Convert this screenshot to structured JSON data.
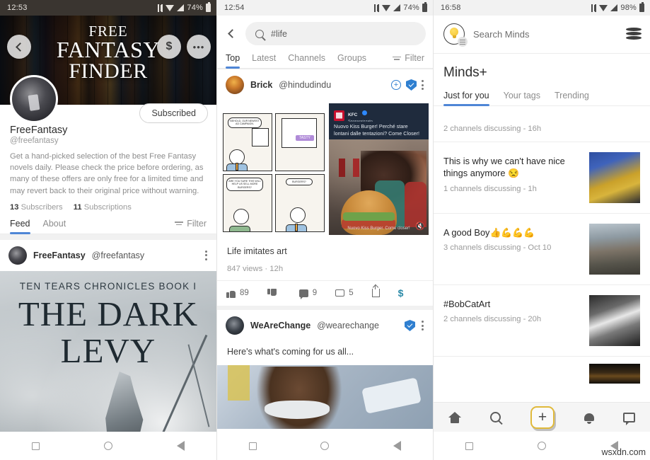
{
  "panel1": {
    "statusbar": {
      "time": "12:53",
      "battery": "74%"
    },
    "banner": {
      "line1": "FREE",
      "line2": "FANTASY",
      "line3": "FINDER"
    },
    "actions": {
      "back": "back-arrow",
      "tip": "$",
      "more": "•••"
    },
    "subscribe_label": "Subscribed",
    "profile": {
      "name": "FreeFantasy",
      "handle": "@freefantasy",
      "bio": "Get a hand-picked selection of the best Free Fantasy novels daily. Please check the price before ordering, as many of these offers are only free for a limited time and may revert back to their original price without warning.",
      "subscribers_count": "13",
      "subscribers_label": "Subscribers",
      "subscriptions_count": "11",
      "subscriptions_label": "Subscriptions"
    },
    "tabs": [
      {
        "label": "Feed",
        "active": true
      },
      {
        "label": "About",
        "active": false
      }
    ],
    "filter_label": "Filter",
    "post": {
      "user": "FreeFantasy",
      "handle": "@freefantasy",
      "cover_series": "TEN TEARS CHRONICLES BOOK I",
      "cover_title_line1": "THE DARK",
      "cover_title_line2": "LEVY"
    }
  },
  "panel2": {
    "statusbar": {
      "time": "12:54",
      "battery": "74%"
    },
    "search": {
      "value": "#life",
      "placeholder": "Search"
    },
    "tabs": [
      {
        "label": "Top",
        "active": true
      },
      {
        "label": "Latest",
        "active": false
      },
      {
        "label": "Channels",
        "active": false
      },
      {
        "label": "Groups",
        "active": false
      }
    ],
    "filter_label": "Filter",
    "post1": {
      "user": "Brick",
      "handle": "@hindudindu",
      "comic_panels": [
        "BEHOLD, OUR NEWEST AD CAMPAIGN.",
        "TASTY",
        "ARE YOU SURE THIS WILL HELP US SELL MORE BURGERS?",
        "BURGERS?"
      ],
      "video": {
        "brand": "KFC",
        "sponsored": "Sponsorizzato",
        "caption": "Nuovo Kiss Burger! Perché stare lontani dalle tentazioni? Come Closer!",
        "cta": "Nuovo Kiss Burger. Come closer!"
      },
      "caption": "Life imitates art",
      "meta": "847 views · 12h",
      "stats": {
        "likes": "89",
        "dislikes": "",
        "comments": "9",
        "reminds": "5",
        "share": "",
        "tip": "$"
      }
    },
    "post2": {
      "user": "WeAreChange",
      "handle": "@wearechange",
      "caption": "Here's what's coming for us all..."
    }
  },
  "panel3": {
    "statusbar": {
      "time": "16:58",
      "battery": "98%"
    },
    "header": {
      "search_placeholder": "Search Minds",
      "logo": "minds-bulb-logo",
      "coins": "tokens-icon"
    },
    "title": "Minds+",
    "tabs": [
      {
        "label": "Just for you",
        "active": true
      },
      {
        "label": "Your tags",
        "active": false
      },
      {
        "label": "Trending",
        "active": false
      }
    ],
    "items": [
      {
        "title": "",
        "sub": "2 channels discussing - 16h",
        "thumb": "",
        "partial_top": true
      },
      {
        "title": "This is why we can't have nice things anymore 😒",
        "sub": "1 channels discussing - 1h",
        "thumb": "th-a"
      },
      {
        "title": "A good Boy👍💪💪💪",
        "sub": "3 channels discussing - Oct 10",
        "thumb": "th-b"
      },
      {
        "title": "#BobCatArt",
        "sub": "2 channels discussing - 20h",
        "thumb": "th-c"
      }
    ],
    "bottom_nav": [
      {
        "name": "home",
        "label": "Home"
      },
      {
        "name": "search",
        "label": "Search"
      },
      {
        "name": "compose",
        "label": "+"
      },
      {
        "name": "notifications",
        "label": "Notifications"
      },
      {
        "name": "messages",
        "label": "Messages"
      }
    ]
  },
  "watermark": "wsxdn.com"
}
